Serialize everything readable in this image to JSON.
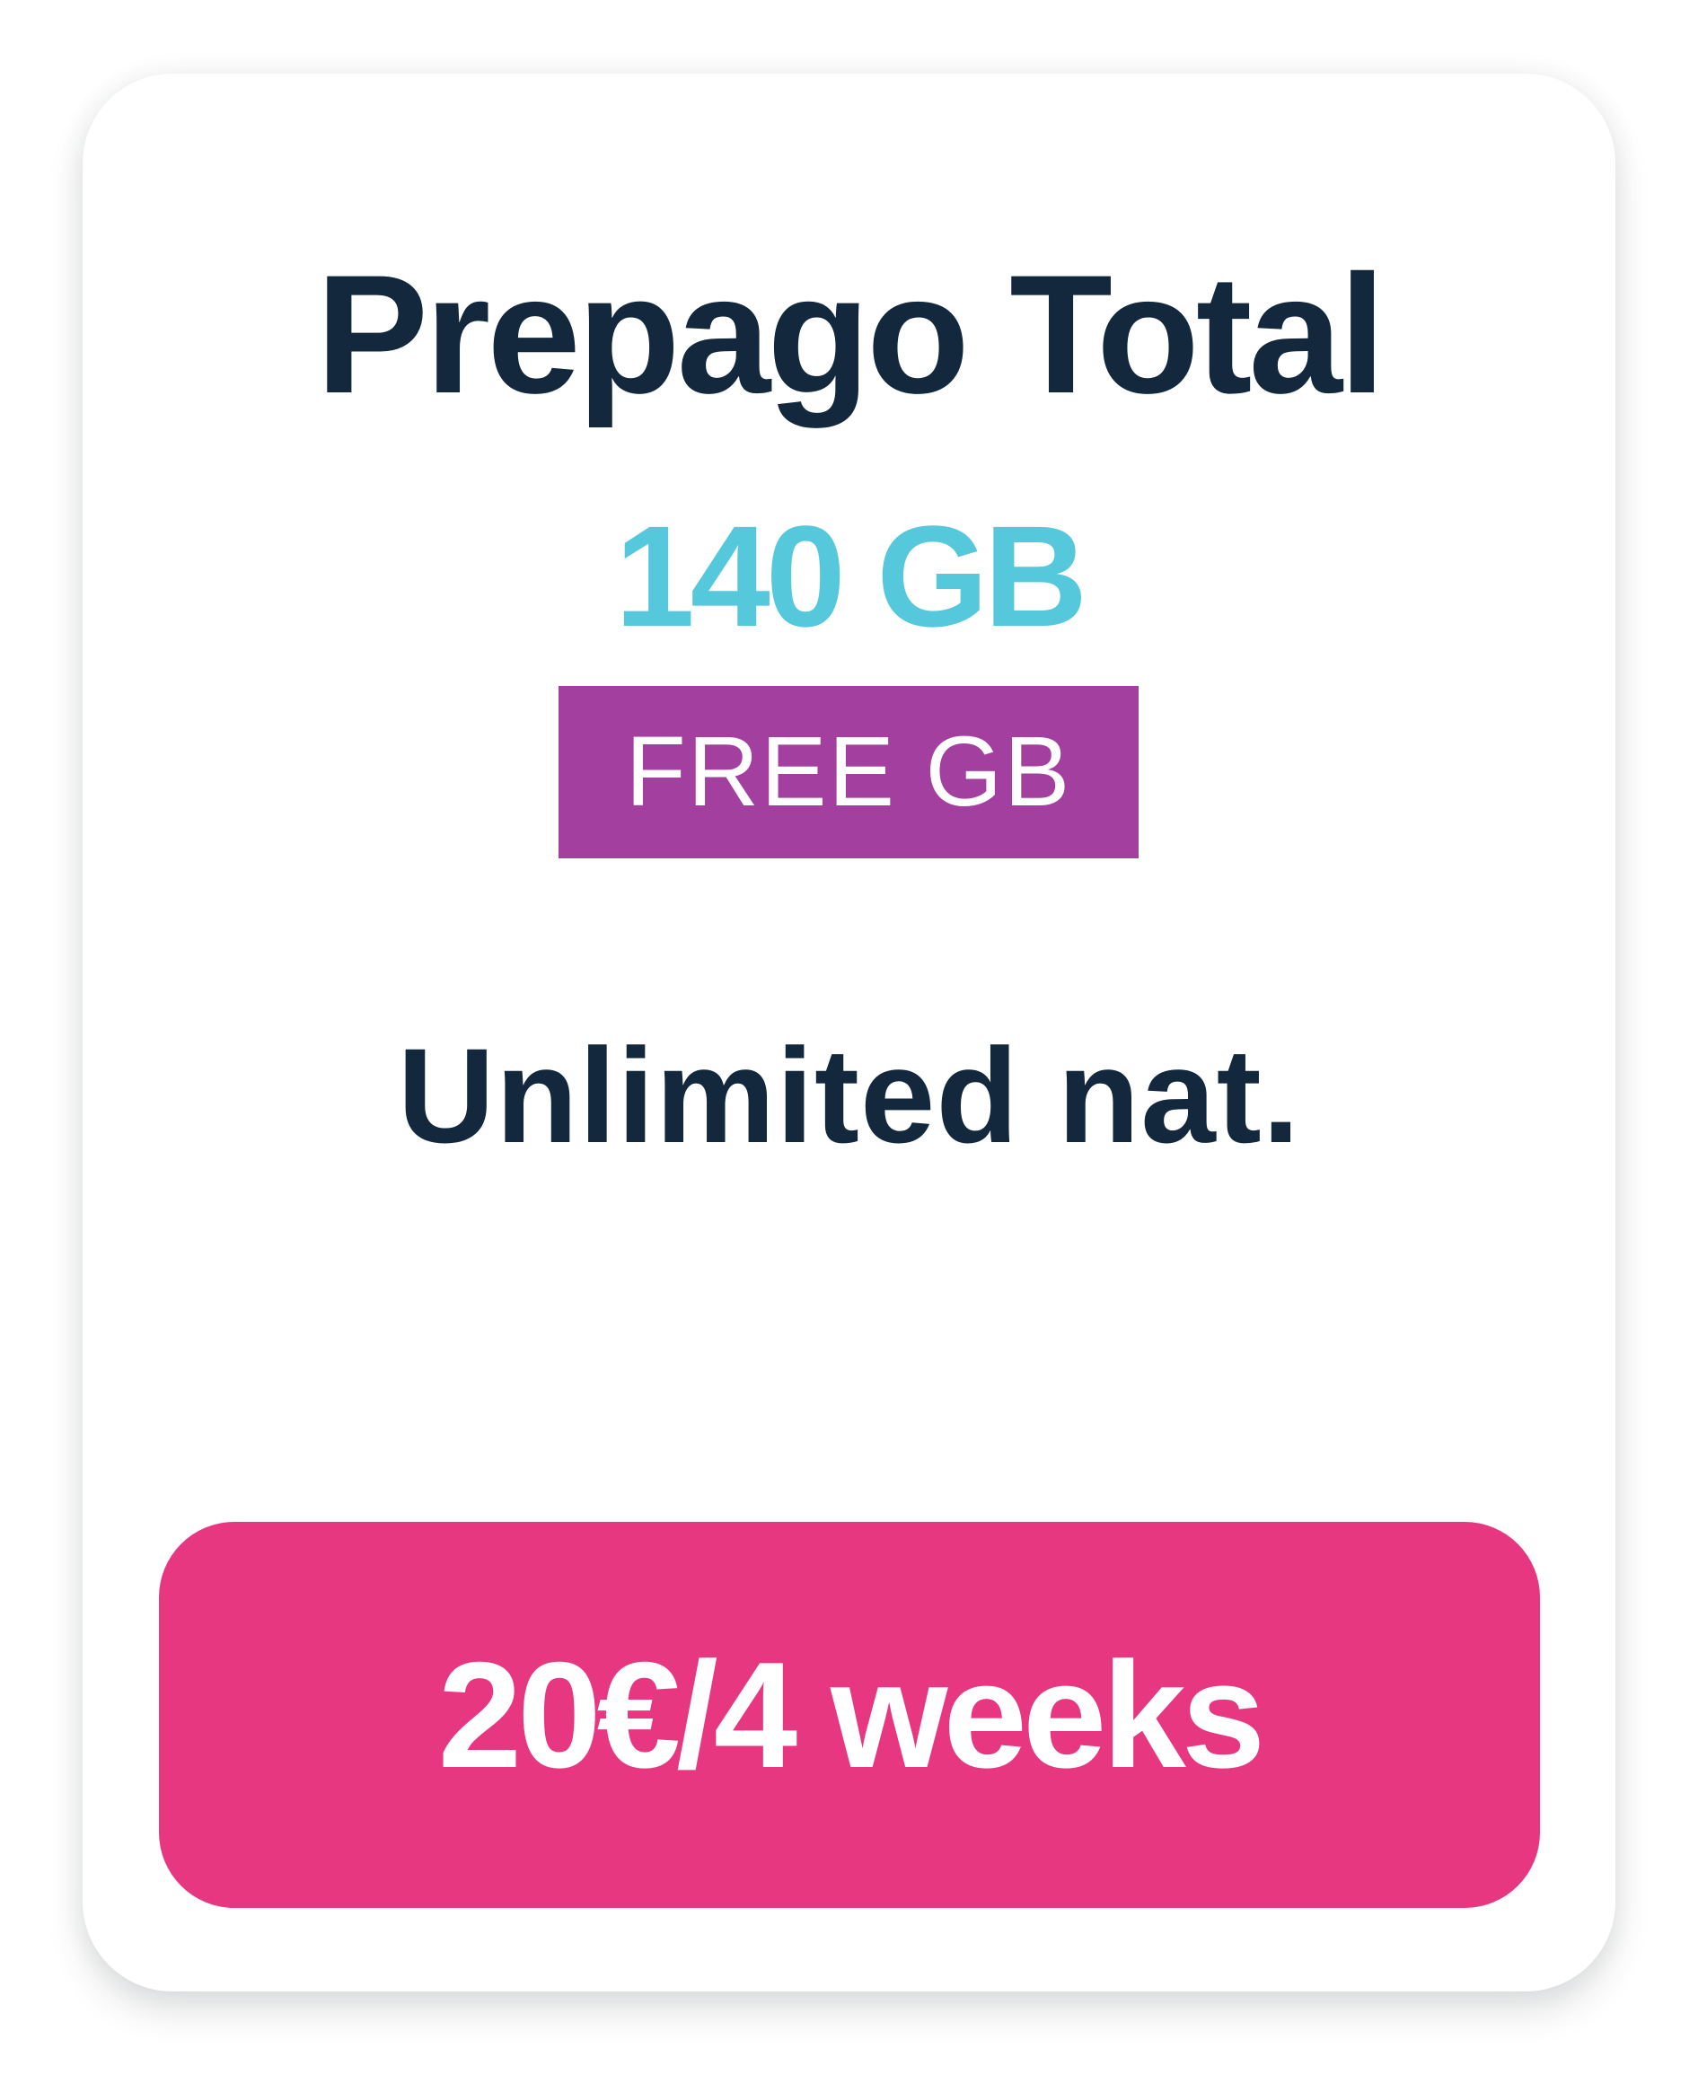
{
  "plan": {
    "title": "Prepago Total",
    "data_amount": "140 GB",
    "badge": "FREE GB",
    "calls": "Unlimited nat.",
    "price": "20€/4 weeks"
  },
  "colors": {
    "title": "#13283d",
    "data": "#55c8dc",
    "badge_bg": "#a23f9f",
    "button_bg": "#e73781"
  }
}
